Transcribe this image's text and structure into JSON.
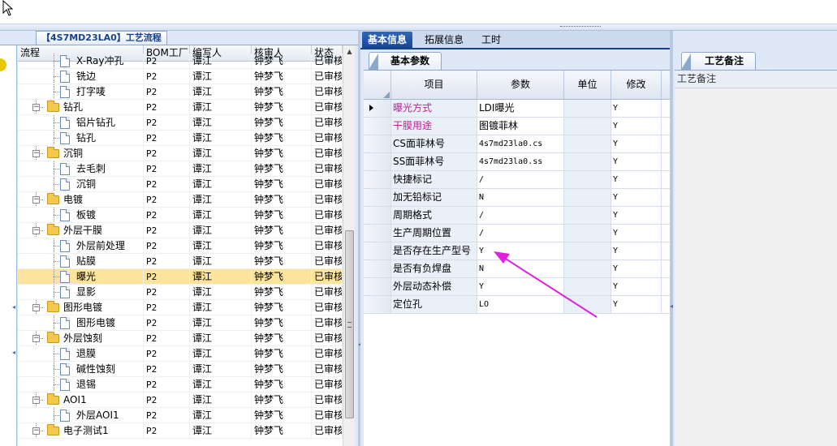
{
  "left_panel": {
    "title": "【4S7MD23LA0】工艺流程",
    "columns": [
      "流程",
      "BOM工厂",
      "编写人",
      "核审人",
      "状态"
    ],
    "rows": [
      {
        "type": "leaf",
        "name": "X-Ray冲孔",
        "bom": "P2",
        "writer": "谭江",
        "checker": "钟梦飞",
        "status": "已审核"
      },
      {
        "type": "leaf",
        "name": "铣边",
        "bom": "P2",
        "writer": "谭江",
        "checker": "钟梦飞",
        "status": "已审核"
      },
      {
        "type": "leaf",
        "name": "打字唛",
        "bom": "P2",
        "writer": "谭江",
        "checker": "钟梦飞",
        "status": "已审核"
      },
      {
        "type": "folder",
        "name": "钻孔",
        "bom": "P2",
        "writer": "谭江",
        "checker": "钟梦飞",
        "status": "已审核"
      },
      {
        "type": "leaf",
        "name": "铝片钻孔",
        "bom": "P2",
        "writer": "谭江",
        "checker": "钟梦飞",
        "status": "已审核"
      },
      {
        "type": "leaf",
        "name": "钻孔",
        "bom": "P2",
        "writer": "谭江",
        "checker": "钟梦飞",
        "status": "已审核"
      },
      {
        "type": "folder",
        "name": "沉铜",
        "bom": "P2",
        "writer": "谭江",
        "checker": "钟梦飞",
        "status": "已审核"
      },
      {
        "type": "leaf",
        "name": "去毛刺",
        "bom": "P2",
        "writer": "谭江",
        "checker": "钟梦飞",
        "status": "已审核"
      },
      {
        "type": "leaf",
        "name": "沉铜",
        "bom": "P2",
        "writer": "谭江",
        "checker": "钟梦飞",
        "status": "已审核"
      },
      {
        "type": "folder",
        "name": "电镀",
        "bom": "P2",
        "writer": "谭江",
        "checker": "钟梦飞",
        "status": "已审核"
      },
      {
        "type": "leaf",
        "name": "板镀",
        "bom": "P2",
        "writer": "谭江",
        "checker": "钟梦飞",
        "status": "已审核"
      },
      {
        "type": "folder",
        "name": "外层干膜",
        "bom": "P2",
        "writer": "谭江",
        "checker": "钟梦飞",
        "status": "已审核"
      },
      {
        "type": "leaf",
        "name": "外层前处理",
        "bom": "P2",
        "writer": "谭江",
        "checker": "钟梦飞",
        "status": "已审核"
      },
      {
        "type": "leaf",
        "name": "贴膜",
        "bom": "P2",
        "writer": "谭江",
        "checker": "钟梦飞",
        "status": "已审核"
      },
      {
        "type": "leaf",
        "name": "曝光",
        "bom": "P2",
        "writer": "谭江",
        "checker": "钟梦飞",
        "status": "已审核",
        "selected": true
      },
      {
        "type": "leaf",
        "name": "显影",
        "bom": "P2",
        "writer": "谭江",
        "checker": "钟梦飞",
        "status": "已审核"
      },
      {
        "type": "folder",
        "name": "图形电镀",
        "bom": "P2",
        "writer": "谭江",
        "checker": "钟梦飞",
        "status": "已审核"
      },
      {
        "type": "leaf",
        "name": "图形电镀",
        "bom": "P2",
        "writer": "谭江",
        "checker": "钟梦飞",
        "status": "已审核"
      },
      {
        "type": "folder",
        "name": "外层蚀刻",
        "bom": "P2",
        "writer": "谭江",
        "checker": "钟梦飞",
        "status": "已审核"
      },
      {
        "type": "leaf",
        "name": "退膜",
        "bom": "P2",
        "writer": "谭江",
        "checker": "钟梦飞",
        "status": "已审核"
      },
      {
        "type": "leaf",
        "name": "碱性蚀刻",
        "bom": "P2",
        "writer": "谭江",
        "checker": "钟梦飞",
        "status": "已审核"
      },
      {
        "type": "leaf",
        "name": "退锡",
        "bom": "P2",
        "writer": "谭江",
        "checker": "钟梦飞",
        "status": "已审核"
      },
      {
        "type": "folder",
        "name": "AOI1",
        "bom": "P2",
        "writer": "谭江",
        "checker": "钟梦飞",
        "status": "已审核"
      },
      {
        "type": "leaf",
        "name": "外层AOI1",
        "bom": "P2",
        "writer": "谭江",
        "checker": "钟梦飞",
        "status": "已审核"
      },
      {
        "type": "folder",
        "name": "电子测试1",
        "bom": "P2",
        "writer": "谭江",
        "checker": "钟梦飞",
        "status": "已审核"
      }
    ]
  },
  "middle_panel": {
    "tabs": [
      "基本信息",
      "拓展信息",
      "工时"
    ],
    "active_tab": "基本信息",
    "sub_tab": "基本参数",
    "columns": [
      "项目",
      "参数",
      "单位",
      "修改"
    ],
    "rows": [
      {
        "item": "曝光方式",
        "param": "LDI曝光",
        "unit": "",
        "modify": "Y",
        "pink": true,
        "current": true
      },
      {
        "item": "干膜用途",
        "param": "图镀菲林",
        "unit": "",
        "modify": "Y",
        "pink": true
      },
      {
        "item": "CS面菲林号",
        "param": "4s7md23la0.cs",
        "unit": "",
        "modify": "Y"
      },
      {
        "item": "SS面菲林号",
        "param": "4s7md23la0.ss",
        "unit": "",
        "modify": "Y"
      },
      {
        "item": "快捷标记",
        "param": "/",
        "unit": "",
        "modify": "Y"
      },
      {
        "item": "加无铅标记",
        "param": "N",
        "unit": "",
        "modify": "Y"
      },
      {
        "item": "周期格式",
        "param": "/",
        "unit": "",
        "modify": "Y"
      },
      {
        "item": "生产周期位置",
        "param": "/",
        "unit": "",
        "modify": "Y"
      },
      {
        "item": "是否存在生产型号",
        "param": "Y",
        "unit": "",
        "modify": "Y"
      },
      {
        "item": "是否有负焊盘",
        "param": "N",
        "unit": "",
        "modify": "Y"
      },
      {
        "item": "外层动态补偿",
        "param": "Y",
        "unit": "",
        "modify": "Y"
      },
      {
        "item": "定位孔",
        "param": "LO",
        "unit": "",
        "modify": "Y"
      }
    ]
  },
  "right_panel": {
    "tab": "工艺备注",
    "field_label": "工艺备注",
    "field_value": ""
  },
  "colors": {
    "accent": "#15428b",
    "pink_text": "#c01e9a",
    "selected_row": "#fde49c",
    "annotation_arrow": "#e020e0"
  }
}
